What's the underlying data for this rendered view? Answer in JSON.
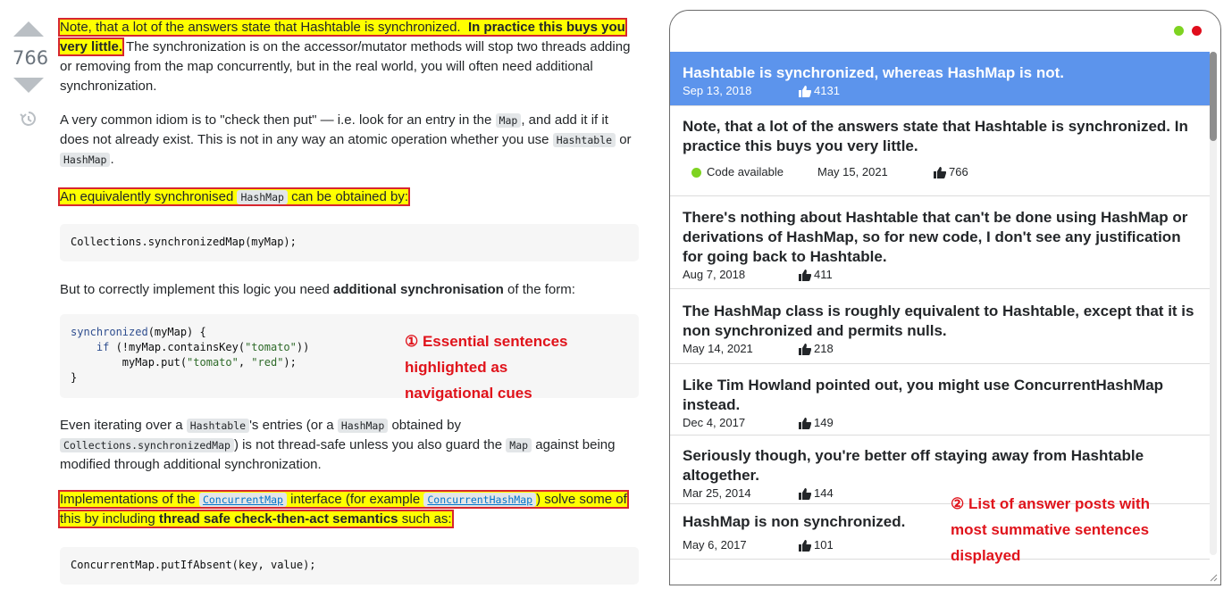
{
  "left": {
    "vote_count": "766",
    "p1": {
      "hl_text": "Note, that a lot of the answers state that Hashtable is synchronized.",
      "bold_text": "In practice this buys you very little.",
      "rest_text": "The synchronization is on the accessor/mutator methods will stop two threads adding or removing from the map concurrently, but in the real world, you will often need additional synchronization."
    },
    "p2": {
      "text_a": "A very common idiom is to \"check then put\" — i.e.  look for an entry in the",
      "code_map": "Map",
      "text_b": ", and add it if it does not already exist.  This is not in any way an atomic operation whether you use",
      "code_hashtable": "Hashtable",
      "text_c": "or",
      "code_hashmap": "HashMap",
      "text_d": "."
    },
    "p3": {
      "text_a": "An equivalently synchronised",
      "code": "HashMap",
      "text_b": "can be obtained by:"
    },
    "code1": "Collections.synchronizedMap(myMap);",
    "p4": {
      "text_a": "But to correctly implement this logic you need",
      "bold": "additional synchronisation",
      "text_b": "of the form:"
    },
    "code2": {
      "l1_kw": "synchronized",
      "l1_rest": "(myMap) {",
      "l2_kw": "if",
      "l2_rest_a": " (!myMap.containsKey(",
      "l2_str": "\"tomato\"",
      "l2_rest_b": "))",
      "l3_a": "myMap.put(",
      "l3_s1": "\"tomato\"",
      "l3_b": ", ",
      "l3_s2": "\"red\"",
      "l3_c": ");",
      "l4": "}"
    },
    "annotation": {
      "line1": "① Essential sentences",
      "line2": "highlighted as",
      "line3": "navigational cues"
    },
    "p5": {
      "text_a": "Even iterating over a",
      "code_hashtable": "Hashtable",
      "text_b": "'s entries (or a",
      "code_hashmap": "HashMap",
      "text_c": "obtained by",
      "code_sync": "Collections.synchronizedMap",
      "text_d": ") is not thread-safe unless you also guard the",
      "code_map": "Map",
      "text_e": "against being modified through additional synchronization."
    },
    "p6": {
      "text_a": "Implementations of the",
      "link1": "ConcurrentMap",
      "text_b": "interface (for example",
      "link2": "ConcurrentHashMap",
      "text_c": ") solve some of this by including",
      "bold": "thread safe check-then-act semantics",
      "text_d": "such as:"
    },
    "code3": "ConcurrentMap.putIfAbsent(key, value);"
  },
  "right": {
    "items": [
      {
        "title": "Hashtable is synchronized, whereas HashMap is not.",
        "date": "Sep 13, 2018",
        "votes": "4131"
      },
      {
        "title": "Note, that a lot of the answers state that Hashtable is synchronized. In practice this buys you very little.",
        "badge": "Code available",
        "date": "May 15, 2021",
        "votes": "766"
      },
      {
        "title": "There's nothing about Hashtable that can't be done using HashMap or derivations of HashMap, so for new code, I don't see any justification for going back to Hashtable.",
        "date": "Aug  7, 2018",
        "votes": "411"
      },
      {
        "title": "The HashMap class is roughly equivalent to Hashtable, except that it is non synchronized and permits nulls.",
        "date": "May 14, 2021",
        "votes": "218"
      },
      {
        "title": "Like Tim Howland pointed out, you might use ConcurrentHashMap instead.",
        "date": "Dec 4, 2017",
        "votes": "149"
      },
      {
        "title": "Seriously though, you're better off staying away from Hashtable altogether.",
        "date": "Mar 25, 2014",
        "votes": "144"
      },
      {
        "title": "HashMap is non synchronized.",
        "date": "May 6, 2017",
        "votes": "101"
      }
    ],
    "annotation": {
      "line1": "② List of answer posts with",
      "line2": "most summative sentences",
      "line3": "displayed"
    },
    "colors": {
      "selected_bg": "#5c94ec",
      "highlight": "#ffff00",
      "annotation": "#e0131b",
      "box": "#d7262f"
    }
  }
}
